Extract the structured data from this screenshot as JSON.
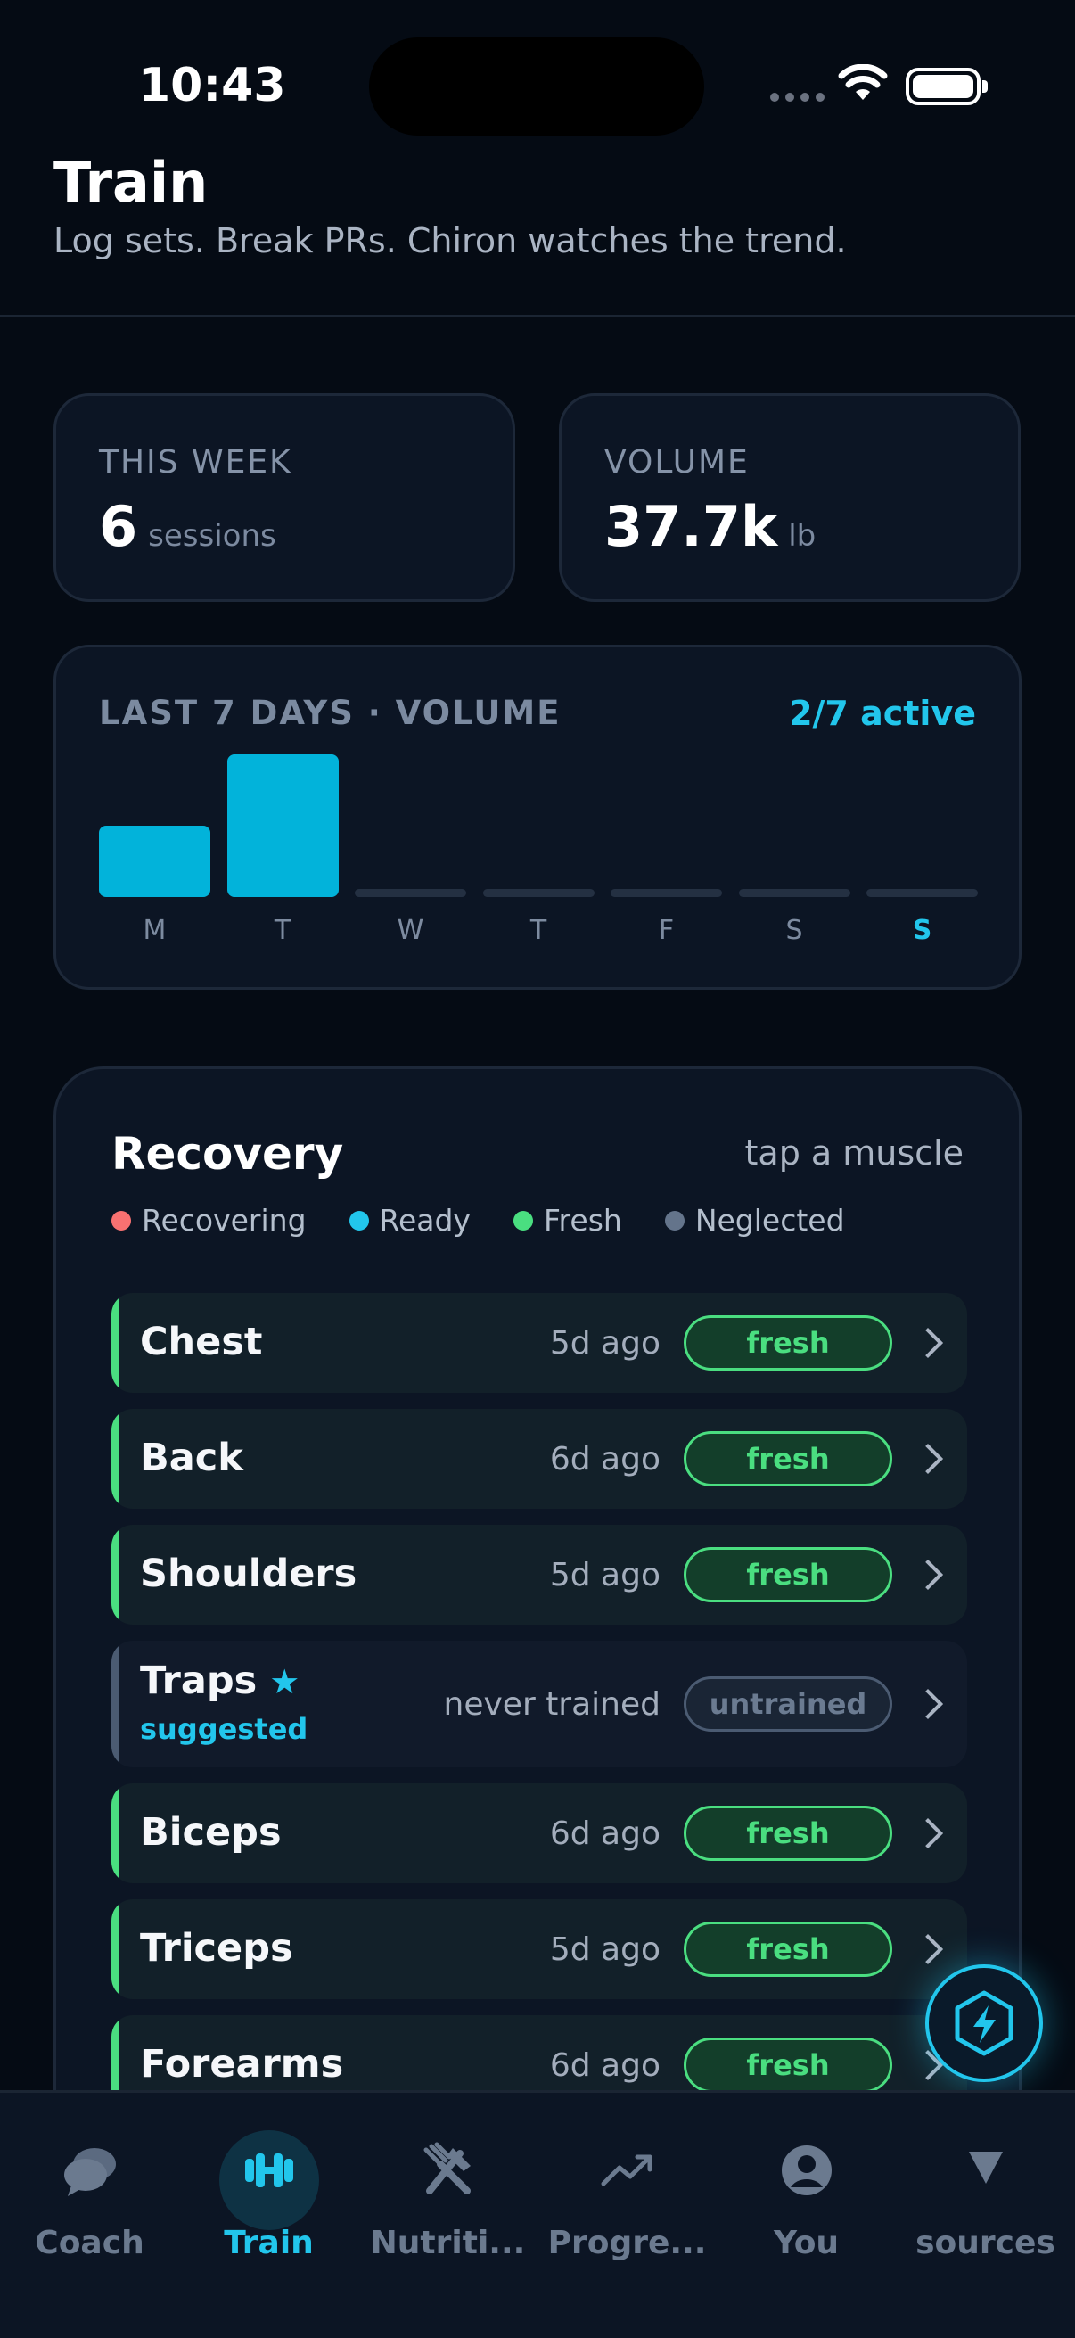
{
  "status_bar": {
    "time": "10:43"
  },
  "header": {
    "title": "Train",
    "subtitle": "Log sets. Break PRs. Chiron watches the trend."
  },
  "stats": [
    {
      "label": "THIS WEEK",
      "value": "6",
      "unit": "sessions"
    },
    {
      "label": "VOLUME",
      "value": "37.7k",
      "unit": "lb"
    }
  ],
  "volume_chart": {
    "title": "LAST 7 DAYS · VOLUME",
    "active_label": "2/7 active",
    "days": [
      "M",
      "T",
      "W",
      "T",
      "F",
      "S",
      "S"
    ],
    "today_index": 6
  },
  "chart_data": {
    "type": "bar",
    "title": "LAST 7 DAYS · VOLUME",
    "categories": [
      "M",
      "T",
      "W",
      "T",
      "F",
      "S",
      "S"
    ],
    "values": [
      0.5,
      1.0,
      0,
      0,
      0,
      0,
      0
    ],
    "xlabel": "",
    "ylabel": "",
    "grid": false,
    "colors": {
      "bar": "#02b3da",
      "empty": "#243042"
    }
  },
  "recovery": {
    "title": "Recovery",
    "hint": "tap a muscle",
    "legend": [
      {
        "label": "Recovering",
        "color": "#f87171"
      },
      {
        "label": "Ready",
        "color": "#22c6ec"
      },
      {
        "label": "Fresh",
        "color": "#4ade80"
      },
      {
        "label": "Neglected",
        "color": "#64748b"
      }
    ],
    "muscles": [
      {
        "name": "Chest",
        "ago": "5d ago",
        "status": "fresh"
      },
      {
        "name": "Back",
        "ago": "6d ago",
        "status": "fresh"
      },
      {
        "name": "Shoulders",
        "ago": "5d ago",
        "status": "fresh"
      },
      {
        "name": "Traps",
        "ago": "never trained",
        "status": "untrained",
        "tag": "suggested"
      },
      {
        "name": "Biceps",
        "ago": "6d ago",
        "status": "fresh"
      },
      {
        "name": "Triceps",
        "ago": "5d ago",
        "status": "fresh"
      },
      {
        "name": "Forearms",
        "ago": "6d ago",
        "status": "fresh"
      }
    ]
  },
  "tab_bar": {
    "tabs": [
      {
        "label": "Coach",
        "icon": "chat-bubble-icon"
      },
      {
        "label": "Train",
        "icon": "dumbbell-icon",
        "active": true
      },
      {
        "label": "Nutriti...",
        "icon": "fork-knife-icon"
      },
      {
        "label": "Progre...",
        "icon": "trend-up-icon"
      },
      {
        "label": "You",
        "icon": "user-circle-icon"
      },
      {
        "label": "sources",
        "icon": "triangle-down-icon"
      }
    ]
  },
  "colors": {
    "accent": "#22c6ec",
    "fresh": "#4ade80",
    "background": "#050b14",
    "card": "#0c1524"
  }
}
